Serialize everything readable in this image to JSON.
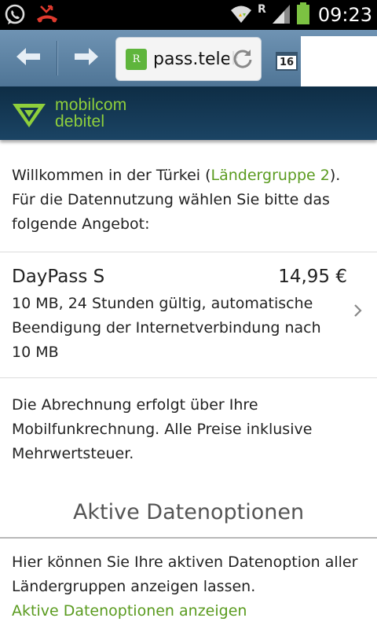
{
  "status_bar": {
    "time": "09:23",
    "icons": [
      "whatsapp-icon",
      "missed-call-icon",
      "wifi-icon",
      "roaming-icon",
      "signal-icon",
      "battery-icon"
    ],
    "roaming_label": "R"
  },
  "browser": {
    "url": "pass.telekom",
    "favicon_letter": "R",
    "tabs_count": "16",
    "icons": [
      "back-arrow-icon",
      "forward-arrow-icon",
      "reload-icon",
      "tabs-icon"
    ]
  },
  "brand": {
    "line1": "mobilcom",
    "line2": "debitel",
    "color": "#8fcf3c"
  },
  "intro": {
    "text_before": "Willkommen in der Türkei (",
    "link": "Ländergruppe 2",
    "text_after": "). Für die Datennutzung wählen Sie bitte das folgende Angebot:"
  },
  "offer": {
    "title": "DayPass S",
    "price": "14,95 €",
    "description": "10 MB, 24 Stunden gültig, automatische Beendigung der Internetverbindung nach 10 MB"
  },
  "billing_note": "Die Abrechnung erfolgt über Ihre Mobilfunkrechnung. Alle Preise inklusive Mehrwertsteuer.",
  "active_section": {
    "title": "Aktive Datenoptionen",
    "text": "Hier können Sie Ihre aktiven Datenoption aller Ländergruppen anzeigen lassen.",
    "link": "Aktive Datenoptionen anzeigen"
  },
  "colors": {
    "link": "#5a9b1f",
    "header": "#1b4464",
    "toolbar": "#5f84a5"
  }
}
